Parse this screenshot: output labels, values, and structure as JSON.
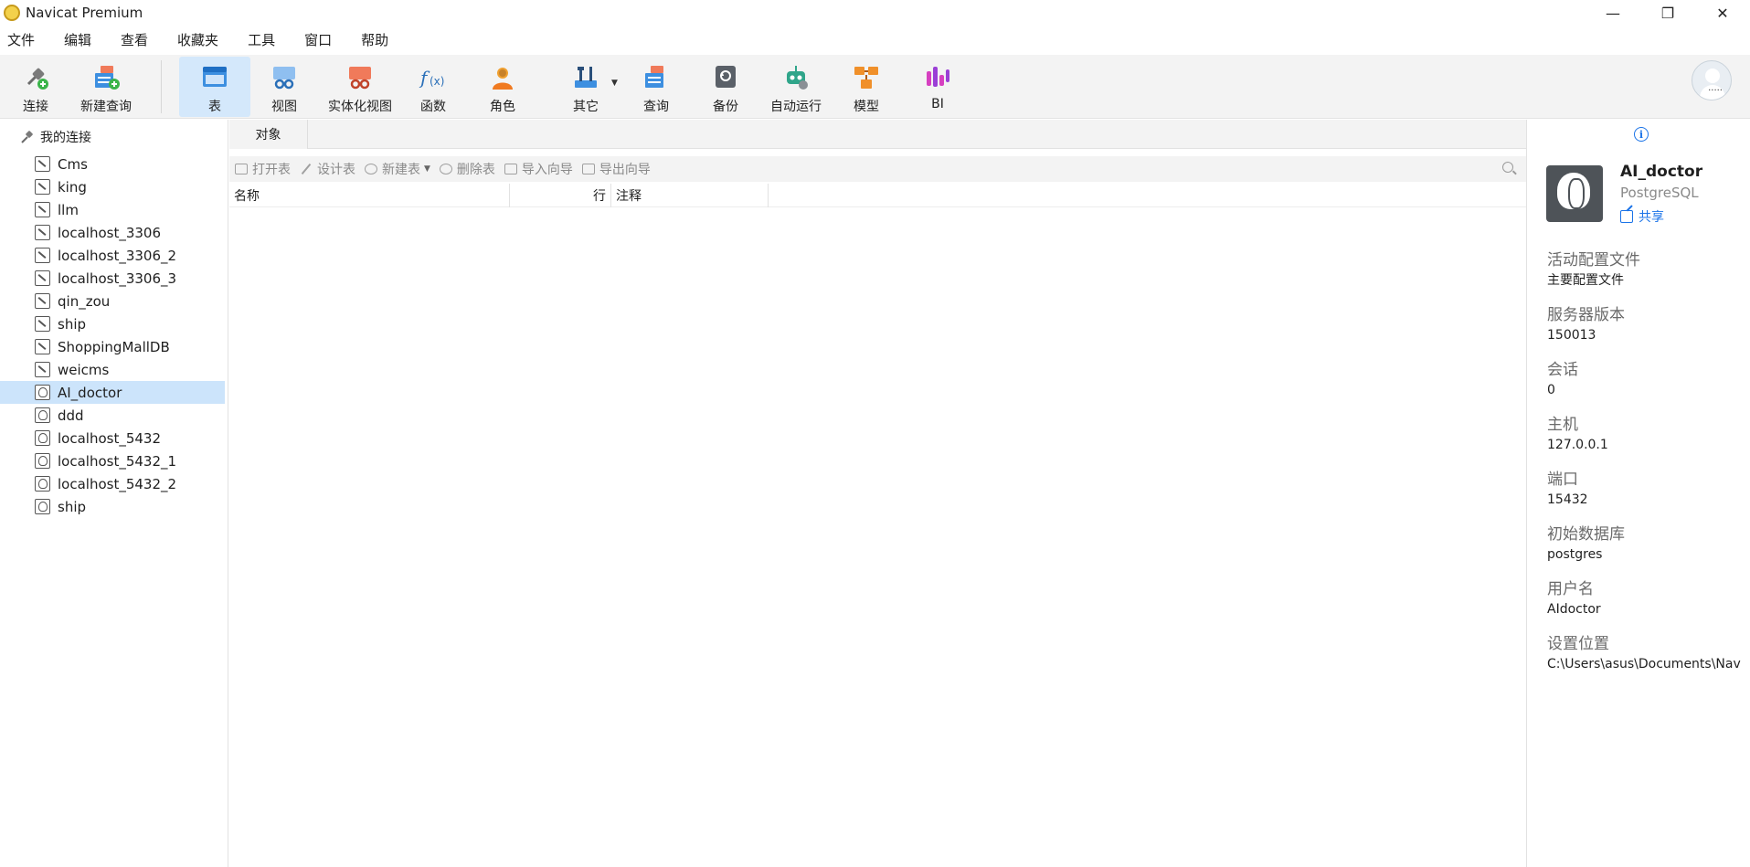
{
  "window": {
    "title": "Navicat Premium",
    "controls": [
      "—",
      "❐",
      "✕"
    ]
  },
  "menu": [
    "文件",
    "编辑",
    "查看",
    "收藏夹",
    "工具",
    "窗口",
    "帮助"
  ],
  "toolbar": {
    "connect": "连接",
    "new_query": "新建查询",
    "table": "表",
    "view": "视图",
    "materialized_view": "实体化视图",
    "function": "函数",
    "role": "角色",
    "other": "其它",
    "query": "查询",
    "backup": "备份",
    "automation": "自动运行",
    "model": "模型",
    "bi": "BI"
  },
  "avatar_dots": "·····",
  "sidebar": {
    "root_label": "我的连接",
    "connections": [
      {
        "name": "Cms",
        "type": "mysql"
      },
      {
        "name": "king",
        "type": "mysql"
      },
      {
        "name": "llm",
        "type": "mysql"
      },
      {
        "name": "localhost_3306",
        "type": "mysql"
      },
      {
        "name": "localhost_3306_2",
        "type": "mysql"
      },
      {
        "name": "localhost_3306_3",
        "type": "mysql"
      },
      {
        "name": "qin_zou",
        "type": "mysql"
      },
      {
        "name": "ship",
        "type": "mysql"
      },
      {
        "name": "ShoppingMallDB",
        "type": "mysql"
      },
      {
        "name": "weicms",
        "type": "mysql"
      },
      {
        "name": "AI_doctor",
        "type": "pg",
        "selected": true
      },
      {
        "name": "ddd",
        "type": "pg"
      },
      {
        "name": "localhost_5432",
        "type": "pg"
      },
      {
        "name": "localhost_5432_1",
        "type": "pg"
      },
      {
        "name": "localhost_5432_2",
        "type": "pg"
      },
      {
        "name": "ship",
        "type": "pg"
      }
    ]
  },
  "main": {
    "tab": "对象",
    "actions": {
      "open_table": "打开表",
      "design_table": "设计表",
      "new_table": "新建表",
      "delete_table": "删除表",
      "import_wizard": "导入向导",
      "export_wizard": "导出向导"
    },
    "columns": {
      "name": "名称",
      "rows": "行",
      "comment": "注释"
    }
  },
  "info": {
    "info_icon": "i",
    "name": "AI_doctor",
    "type": "PostgreSQL",
    "share": "共享",
    "properties": [
      {
        "label": "活动配置文件",
        "value": "主要配置文件"
      },
      {
        "label": "服务器版本",
        "value": "150013"
      },
      {
        "label": "会话",
        "value": "0"
      },
      {
        "label": "主机",
        "value": "127.0.0.1"
      },
      {
        "label": "端口",
        "value": "15432"
      },
      {
        "label": "初始数据库",
        "value": "postgres"
      },
      {
        "label": "用户名",
        "value": "AIdoctor"
      },
      {
        "label": "设置位置",
        "value": "C:\\Users\\asus\\Documents\\Nav"
      }
    ]
  },
  "colors": {
    "accent": "#1a73e8",
    "selected_row": "#cce4fb",
    "active_tool": "#d4e8fb",
    "toolbar_bg": "#f3f3f3"
  }
}
